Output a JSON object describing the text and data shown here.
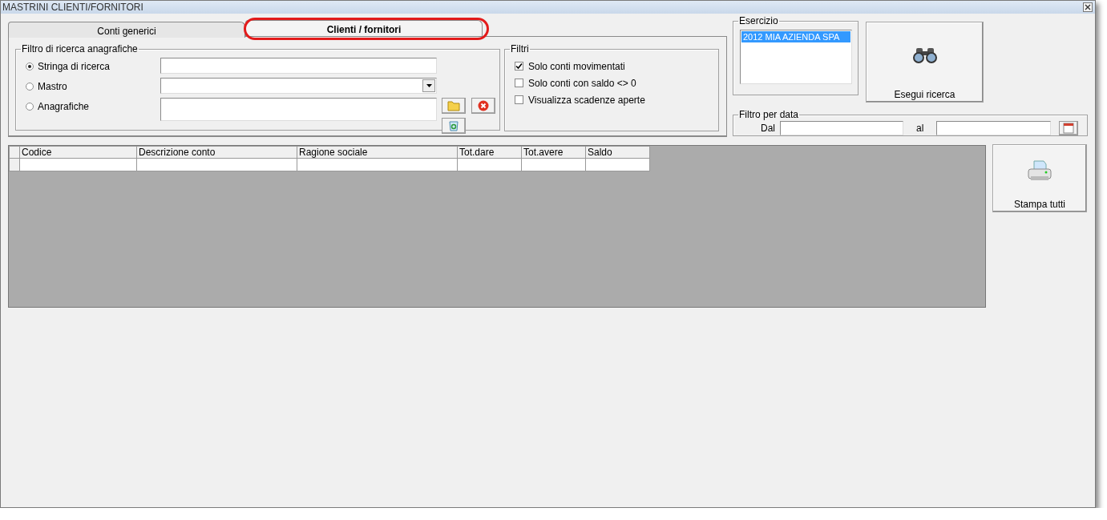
{
  "window": {
    "title": "MASTRINI CLIENTI/FORNITORI"
  },
  "tabs": [
    {
      "label": "Conti generici",
      "selected": false,
      "circled": false
    },
    {
      "label": "Clienti / fornitori",
      "selected": true,
      "circled": true
    }
  ],
  "search_filter": {
    "title": "Filtro di ricerca anagrafiche",
    "options": [
      {
        "label": "Stringa di ricerca",
        "selected": true,
        "kind": "text"
      },
      {
        "label": "Mastro",
        "selected": false,
        "kind": "dropdown"
      },
      {
        "label": "Anagrafiche",
        "selected": false,
        "kind": "multiline"
      }
    ]
  },
  "filters": {
    "title": "Filtri",
    "items": [
      {
        "label": "Solo conti movimentati",
        "checked": true
      },
      {
        "label": "Solo conti con saldo <> 0",
        "checked": false
      },
      {
        "label": "Visualizza scadenze aperte",
        "checked": false
      }
    ]
  },
  "esercizio": {
    "title": "Esercizio",
    "items": [
      {
        "label": "2012 MIA AZIENDA SPA",
        "selected": true
      }
    ]
  },
  "search_button": {
    "label": "Esegui ricerca"
  },
  "date_filter": {
    "title": "Filtro per data",
    "from_label": "Dal",
    "to_label": "al"
  },
  "table": {
    "columns": [
      "Codice",
      "Descrizione conto",
      "Ragione sociale",
      "Tot.dare",
      "Tot.avere",
      "Saldo"
    ]
  },
  "print_button": {
    "label": "Stampa tutti"
  }
}
